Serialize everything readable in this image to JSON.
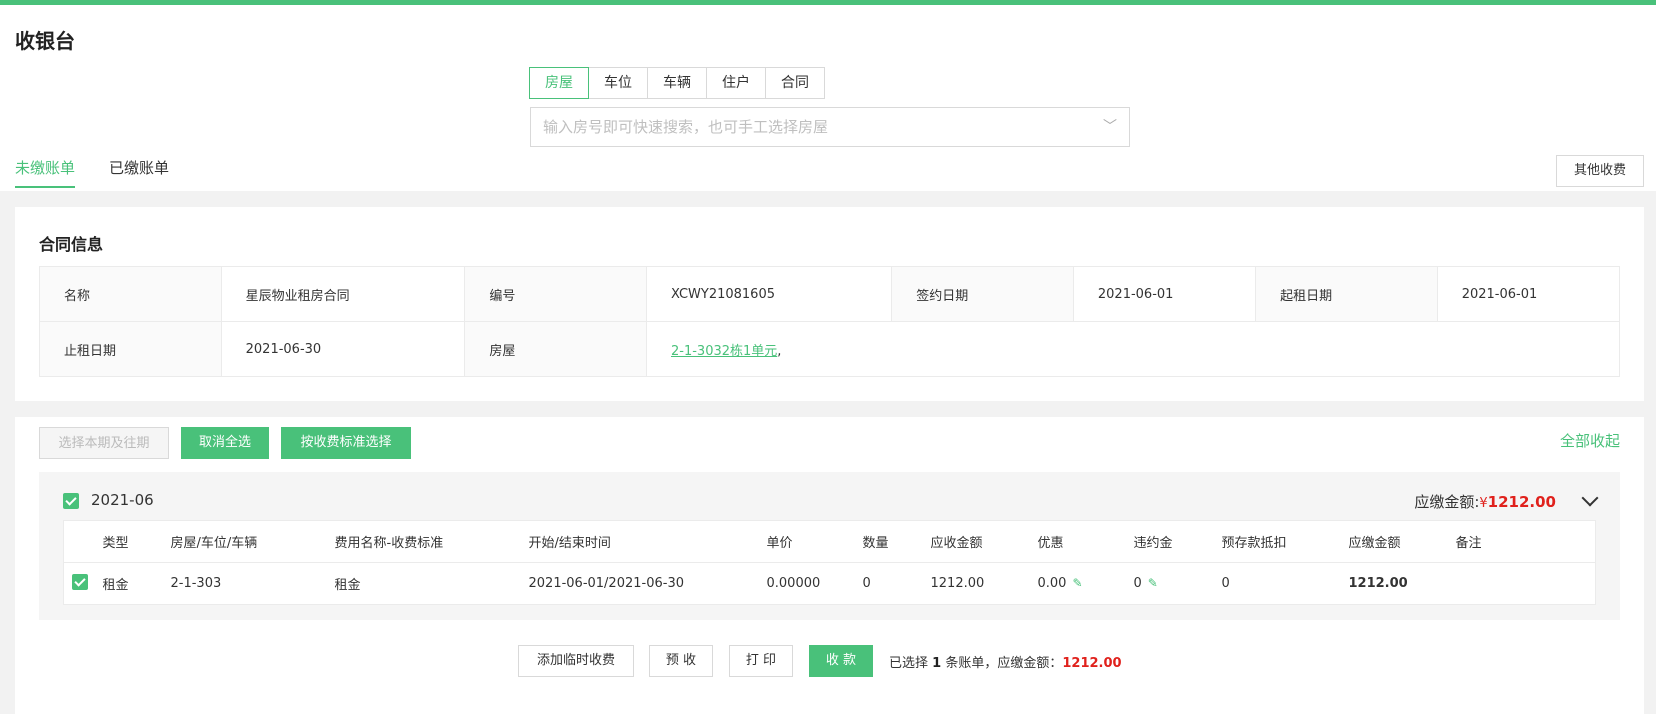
{
  "page": {
    "title": "收银台"
  },
  "type_tabs": [
    "房屋",
    "车位",
    "车辆",
    "住户",
    "合同"
  ],
  "search": {
    "placeholder": "输入房号即可快速搜索，也可手工选择房屋",
    "value": ""
  },
  "bill_tabs": [
    "未缴账单",
    "已缴账单"
  ],
  "other_fee_label": "其他收费",
  "contract": {
    "title": "合同信息",
    "name_label": "名称",
    "name": "星辰物业租房合同",
    "code_label": "编号",
    "code": "XCWY21081605",
    "sign_label": "签约日期",
    "sign_date": "2021-06-01",
    "start_label": "起租日期",
    "start_date": "2021-06-01",
    "end_label": "止租日期",
    "end_date": "2021-06-30",
    "house_label": "房屋",
    "house": "2-1-3032栋1单元",
    "house_suffix": ","
  },
  "actions": {
    "select_current_past": "选择本期及往期",
    "cancel_all": "取消全选",
    "by_standard": "按收费标准选择",
    "collapse_all": "全部收起"
  },
  "group": {
    "period": "2021-06",
    "due_label": "应缴金额:",
    "currency": "¥",
    "due_amount": "1212.00"
  },
  "fee_table": {
    "headers": [
      "类型",
      "房屋/车位/车辆",
      "费用名称-收费标准",
      "开始/结束时间",
      "单价",
      "数量",
      "应收金额",
      "优惠",
      "违约金",
      "预存款抵扣",
      "应缴金额",
      "备注"
    ],
    "rows": [
      {
        "type": "租金",
        "house": "2-1-303",
        "fee_name": "租金",
        "period": "2021-06-01/2021-06-30",
        "unit_price": "0.00000",
        "quantity": "0",
        "receivable": "1212.00",
        "discount": "0.00",
        "penalty": "0",
        "prepay_deduct": "0",
        "payable": "1212.00",
        "remark": ""
      }
    ]
  },
  "bottom": {
    "add_temp": "添加临时收费",
    "prepay": "预 收",
    "print": "打 印",
    "collect": "收 款",
    "summary_prefix": "已选择",
    "summary_count": "1",
    "summary_mid": "条账单，应缴金额：",
    "summary_amount": "1212.00"
  },
  "colors": {
    "accent": "#49c17a",
    "amount_red": "#e0211c"
  },
  "icons": {
    "dropdown": "chevron-down-icon",
    "edit": "pencil-icon",
    "checkbox": "checkbox-checked-icon",
    "collapse": "chevron-down-icon"
  }
}
